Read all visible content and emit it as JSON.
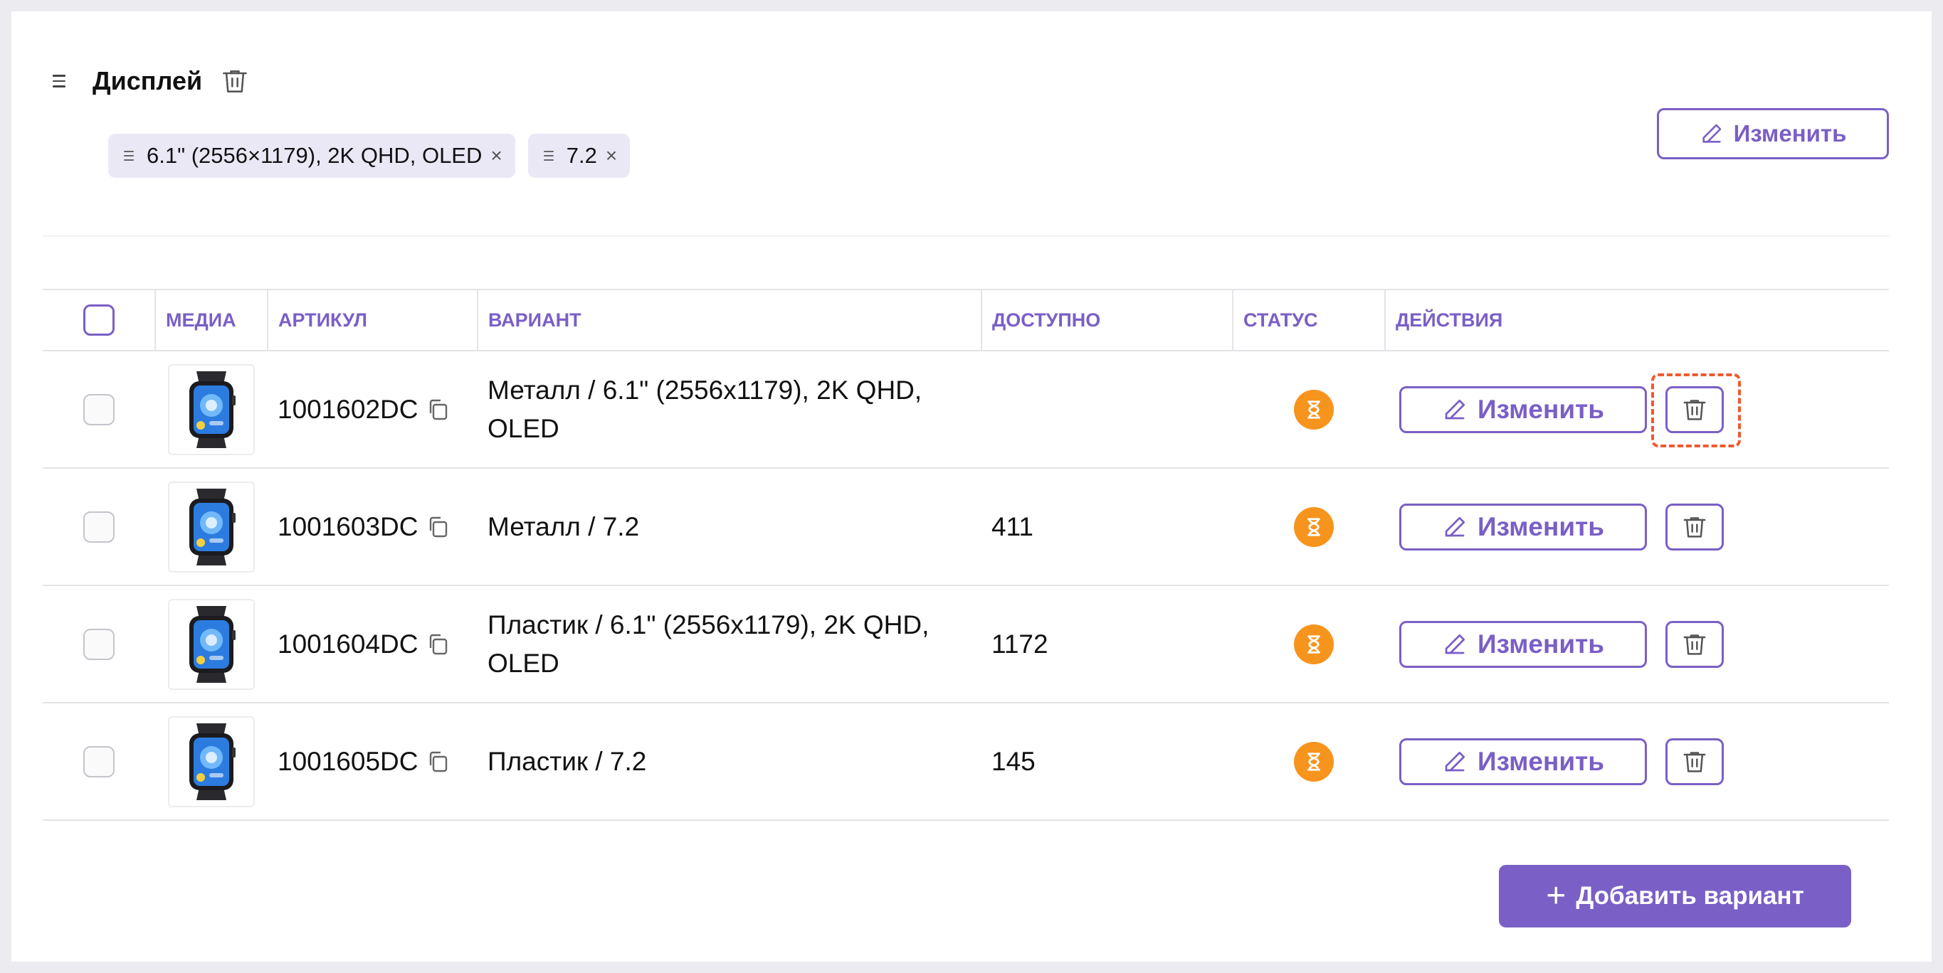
{
  "attribute": {
    "title": "Дисплей",
    "values": [
      {
        "label": "6.1\" (2556×1179), 2K QHD, OLED"
      },
      {
        "label": "7.2"
      }
    ],
    "edit_label": "Изменить"
  },
  "table": {
    "headers": {
      "media": "МЕДИА",
      "sku": "АРТИКУЛ",
      "variant": "ВАРИАНТ",
      "available": "ДОСТУПНО",
      "status": "СТАТУС",
      "actions": "ДЕЙСТВИЯ"
    },
    "rows": [
      {
        "sku": "1001602DC",
        "variant": "Металл / 6.1\" (2556x1179), 2K QHD, OLED",
        "available": "",
        "status": "pending-icon",
        "edit_label": "Изменить"
      },
      {
        "sku": "1001603DC",
        "variant": "Металл / 7.2",
        "available": "411",
        "status": "pending-icon",
        "edit_label": "Изменить"
      },
      {
        "sku": "1001604DC",
        "variant": "Пластик / 6.1\" (2556x1179), 2K QHD, OLED",
        "available": "1172",
        "status": "pending-icon",
        "edit_label": "Изменить"
      },
      {
        "sku": "1001605DC",
        "variant": "Пластик / 7.2",
        "available": "145",
        "status": "pending-icon",
        "edit_label": "Изменить"
      }
    ]
  },
  "add_variant_label": "Добавить вариант",
  "colors": {
    "accent": "#7a5fc6",
    "status_pending": "#f7941d",
    "highlight": "#ee5a2e",
    "chip_bg": "#ebe8f6"
  }
}
